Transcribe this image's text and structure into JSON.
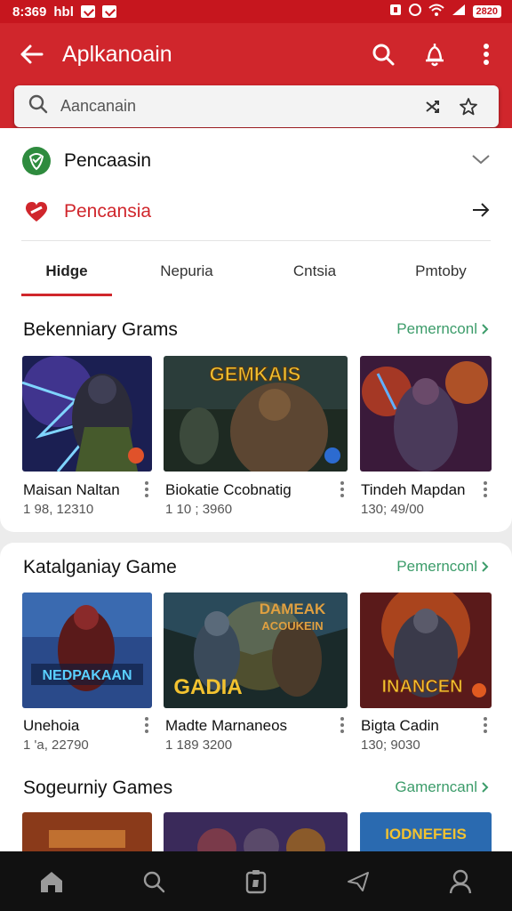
{
  "status_bar": {
    "time": "8:369",
    "carrier": "hbl",
    "battery": "2820"
  },
  "app_bar": {
    "title": "Aplkanoain"
  },
  "search": {
    "placeholder": "Aancanain"
  },
  "menu_rows": [
    {
      "label": "Pencaasin",
      "icon": "shield-icon",
      "color": "#2e8b3e"
    },
    {
      "label": "Pencansia",
      "icon": "heart-icon",
      "color": "#d0262c"
    }
  ],
  "tabs": [
    "Hidge",
    "Nepuria",
    "Cntsia",
    "Pmtoby"
  ],
  "sections": [
    {
      "title": "Bekenniary Grams",
      "link": "Pemernconl",
      "items": [
        {
          "name": "Maisan Naltan",
          "count": "1 98, 12310"
        },
        {
          "name": "Biokatie Ccobnatig",
          "count": "1 10 ; 3960"
        },
        {
          "name": "Tindeh Mapdan",
          "count": "130; 49/00"
        }
      ]
    },
    {
      "title": "Katalganiay Game",
      "link": "Pemernconl",
      "items": [
        {
          "name": "Unehoia",
          "count": "1 'a, 22790"
        },
        {
          "name": "Madte Marnaneos",
          "count": "1 189 3200"
        },
        {
          "name": "Bigta Cadin",
          "count": "130; 9030"
        }
      ]
    },
    {
      "title": "Sogeurniy Games",
      "link": "Gamerncanl"
    }
  ],
  "tile_texts": {
    "t2": "GEMKAIS",
    "t4": "NEDPAKAAN",
    "t5a": "DAMEAK",
    "t5b": "ACOUKEIN",
    "t5c": "GADIA",
    "t6": "INANCEN",
    "t9": "IODNEFEIS"
  },
  "colors": {
    "brand": "#d0262c",
    "link": "#3c9c6a"
  }
}
